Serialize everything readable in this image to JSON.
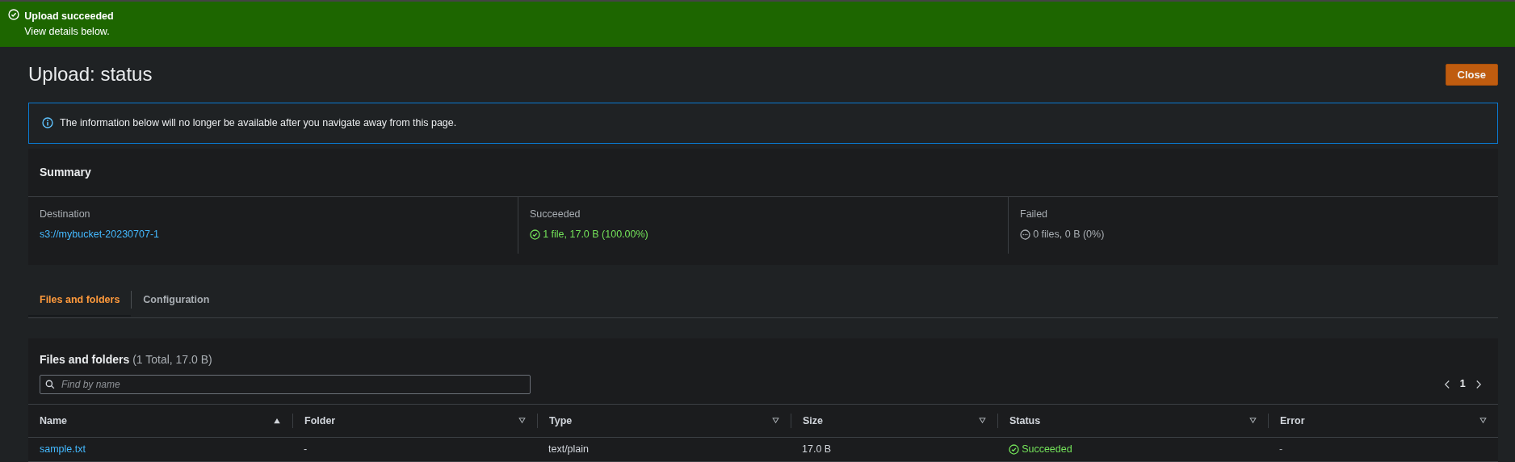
{
  "flash": {
    "title": "Upload succeeded",
    "message": "View details below.",
    "success": true
  },
  "page": {
    "title": "Upload: status",
    "close_button": "Close"
  },
  "info_alert": {
    "text": "The information below will no longer be available after you navigate away from this page."
  },
  "summary": {
    "title": "Summary",
    "items": [
      {
        "label": "Destination",
        "value": "s3://mybucket-20230707-1",
        "kind": "link"
      },
      {
        "label": "Succeeded",
        "value": "1 file, 17.0 B (100.00%)",
        "kind": "success"
      },
      {
        "label": "Failed",
        "value": "0 files, 0 B (0%)",
        "kind": "neutral"
      }
    ]
  },
  "tabs": [
    {
      "label": "Files and folders",
      "selected": true
    },
    {
      "label": "Configuration",
      "selected": false
    }
  ],
  "files": {
    "title": "Files and folders",
    "count": "(1 Total, 17.0 B)",
    "search": {
      "placeholder": "Find by name"
    },
    "pagination": {
      "page": "1"
    },
    "table": {
      "columns": [
        {
          "label": "Name",
          "sorted": true
        },
        {
          "label": "Folder",
          "sorted": false
        },
        {
          "label": "Type",
          "sorted": false
        },
        {
          "label": "Size",
          "sorted": false
        },
        {
          "label": "Status",
          "sorted": false
        },
        {
          "label": "Error",
          "sorted": false
        }
      ],
      "rows": [
        {
          "cells": [
            {
              "text": "sample.txt",
              "kind": "link"
            },
            {
              "text": "-",
              "kind": "plain"
            },
            {
              "text": "text/plain",
              "kind": "plain"
            },
            {
              "text": "17.0 B",
              "kind": "plain"
            },
            {
              "text": "Succeeded",
              "kind": "success"
            },
            {
              "text": "-",
              "kind": "muted"
            }
          ]
        }
      ]
    }
  }
}
